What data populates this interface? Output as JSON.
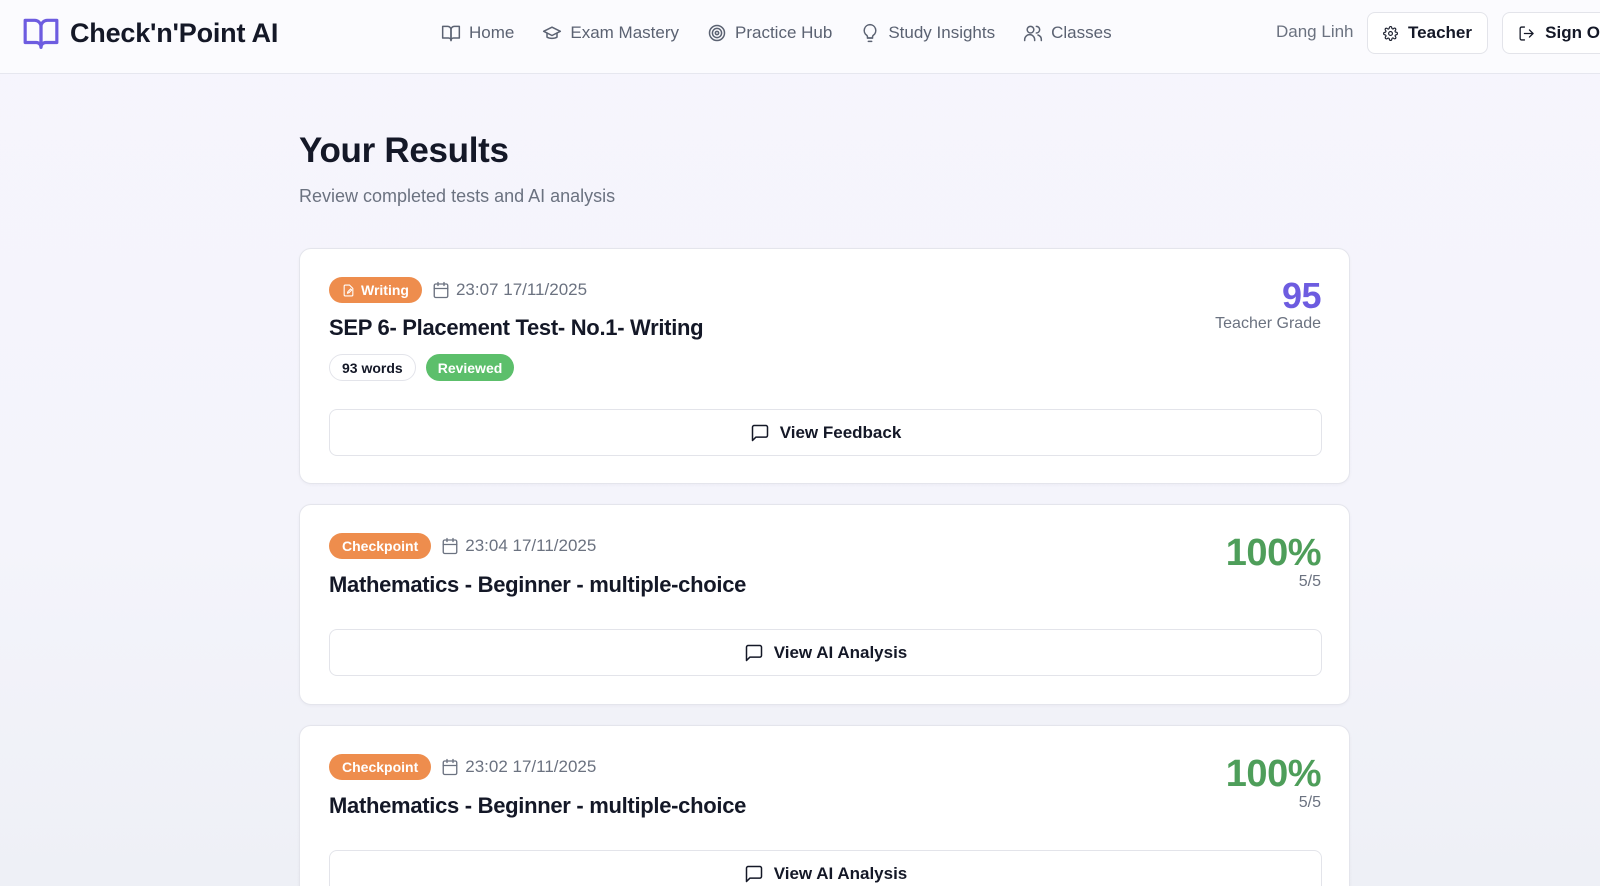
{
  "app": {
    "name": "Check'n'Point AI",
    "brand_color": "#6d5ce0"
  },
  "nav": {
    "items": [
      {
        "label": "Home",
        "icon": "book-icon"
      },
      {
        "label": "Exam Mastery",
        "icon": "graduation-cap-icon"
      },
      {
        "label": "Practice Hub",
        "icon": "target-icon"
      },
      {
        "label": "Study Insights",
        "icon": "lightbulb-icon"
      },
      {
        "label": "Classes",
        "icon": "users-icon"
      }
    ]
  },
  "user": {
    "name": "Dang Linh",
    "role_button": "Teacher",
    "signout_label": "Sign Out"
  },
  "page": {
    "title": "Your Results",
    "subtitle": "Review completed tests and AI analysis"
  },
  "results": [
    {
      "type": "Writing",
      "date": "23:07 17/11/2025",
      "title": "SEP 6- Placement Test- No.1- Writing",
      "word_count": "93 words",
      "status": "Reviewed",
      "score": "95",
      "score_label": "Teacher Grade",
      "score_color": "#6d5ce0",
      "action": "View Feedback"
    },
    {
      "type": "Checkpoint",
      "date": "23:04 17/11/2025",
      "title": "Mathematics - Beginner - multiple-choice",
      "score": "100%",
      "score_label": "5/5",
      "score_color": "#4e9e5a",
      "action": "View AI Analysis"
    },
    {
      "type": "Checkpoint",
      "date": "23:02 17/11/2025",
      "title": "Mathematics - Beginner - multiple-choice",
      "score": "100%",
      "score_label": "5/5",
      "score_color": "#4e9e5a",
      "action": "View AI Analysis"
    }
  ],
  "colors": {
    "badge_orange": "#ee8d4d",
    "reviewed_green": "#5cbf6b"
  }
}
